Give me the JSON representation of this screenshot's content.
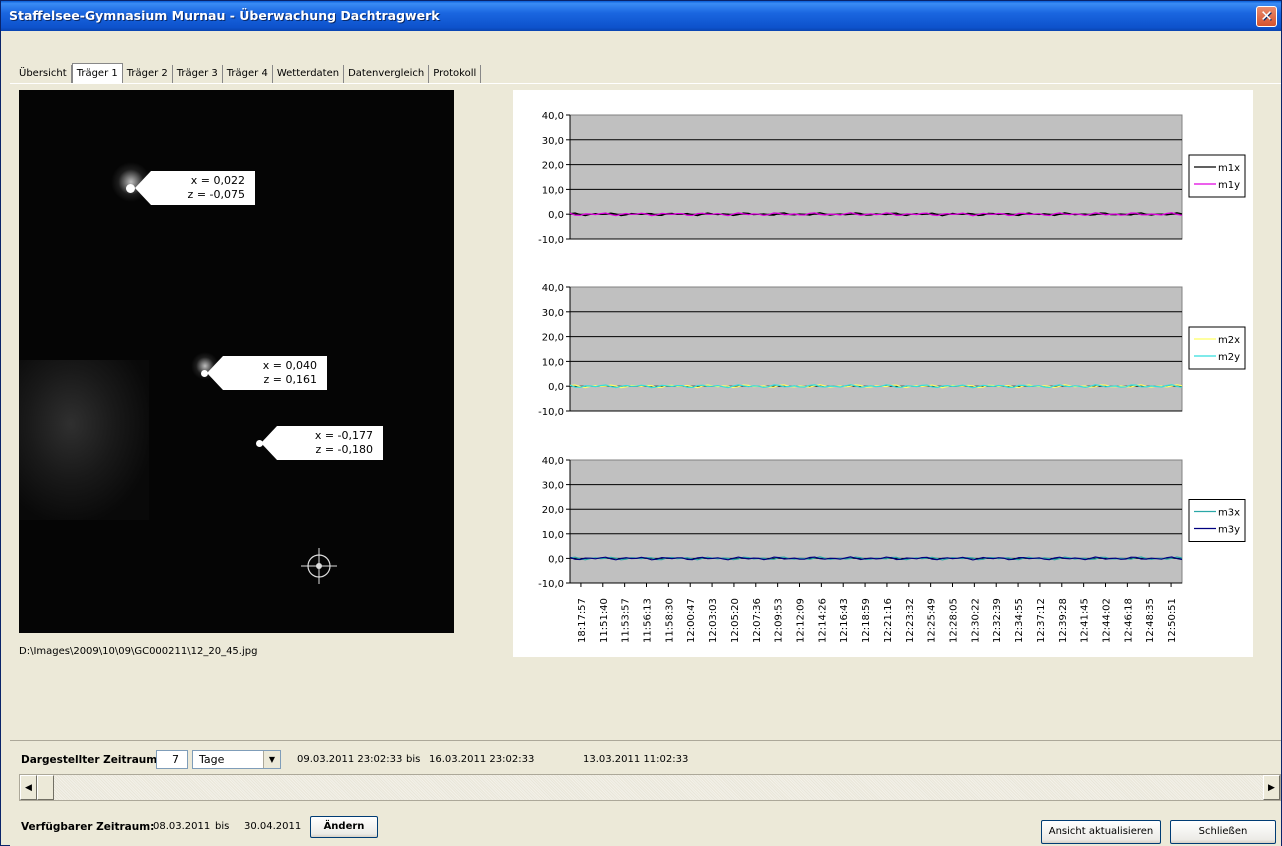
{
  "window": {
    "title": "Staffelsee-Gymnasium Murnau - Überwachung Dachtragwerk",
    "close_glyph": "✕"
  },
  "tabs": [
    {
      "label": "Übersicht"
    },
    {
      "label": "Träger 1"
    },
    {
      "label": "Träger 2"
    },
    {
      "label": "Träger 3"
    },
    {
      "label": "Träger 4"
    },
    {
      "label": "Wetterdaten"
    },
    {
      "label": "Datenvergleich"
    },
    {
      "label": "Protokoll"
    }
  ],
  "active_tab": "Träger 1",
  "camera": {
    "markers": [
      {
        "x_text": "x = 0,022",
        "z_text": "z = -0,075"
      },
      {
        "x_text": "x = 0,040",
        "z_text": "z = 0,161"
      },
      {
        "x_text": "x = -0,177",
        "z_text": "z = -0,180"
      }
    ],
    "file_path": "D:\\Images\\2009\\10\\09\\GC000211\\12_20_45.jpg"
  },
  "chart_data": [
    {
      "type": "line",
      "ylim": [
        -10,
        40
      ],
      "yticks": [
        "40,0",
        "30,0",
        "20,0",
        "10,0",
        "0,0",
        "-10,0"
      ],
      "series": [
        {
          "name": "m1x",
          "color": "#000000",
          "approx_value": 0.0
        },
        {
          "name": "m1y",
          "color": "#e000e0",
          "approx_value": 0.0
        }
      ]
    },
    {
      "type": "line",
      "ylim": [
        -10,
        40
      ],
      "yticks": [
        "40,0",
        "30,0",
        "20,0",
        "10,0",
        "0,0",
        "-10,0"
      ],
      "series": [
        {
          "name": "m2x",
          "color": "#ffff66",
          "approx_value": 0.0
        },
        {
          "name": "m2y",
          "color": "#33dddd",
          "approx_value": 0.0
        }
      ]
    },
    {
      "type": "line",
      "ylim": [
        -10,
        40
      ],
      "yticks": [
        "40,0",
        "30,0",
        "20,0",
        "10,0",
        "0,0",
        "-10,0"
      ],
      "x": [
        "18:17:57",
        "11:51:40",
        "11:53:57",
        "11:56:13",
        "11:58:30",
        "12:00:47",
        "12:03:03",
        "12:05:20",
        "12:07:36",
        "12:09:53",
        "12:12:09",
        "12:14:26",
        "12:16:43",
        "12:18:59",
        "12:21:16",
        "12:23:32",
        "12:25:49",
        "12:28:05",
        "12:30:22",
        "12:32:39",
        "12:34:55",
        "12:37:12",
        "12:39:28",
        "12:41:45",
        "12:44:02",
        "12:46:18",
        "12:48:35",
        "12:50:51"
      ],
      "series": [
        {
          "name": "m3x",
          "color": "#2aa7a7",
          "approx_value": 0.0
        },
        {
          "name": "m3y",
          "color": "#000080",
          "approx_value": 0.0
        }
      ]
    }
  ],
  "bottom": {
    "range_label": "Dargestellter Zeitraum:",
    "range_value": "7",
    "range_unit": "Tage",
    "range_from": "09.03.2011 23:02:33",
    "bis1": "bis",
    "range_to": "16.03.2011 23:02:33",
    "current_time": "13.03.2011 11:02:33",
    "avail_label": "Verfügbarer Zeitraum:",
    "avail_from": "08.03.2011",
    "bis2": "bis",
    "avail_to": "30.04.2011",
    "change_btn": "Ändern",
    "refresh_btn": "Ansicht aktualisieren",
    "close_btn": "Schließen",
    "dropdown_glyph": "▼",
    "scroll_left_glyph": "◀",
    "scroll_right_glyph": "▶"
  },
  "colors": {
    "plot_bg": "#c0c0c0",
    "titlebar": "#0d52cc"
  }
}
